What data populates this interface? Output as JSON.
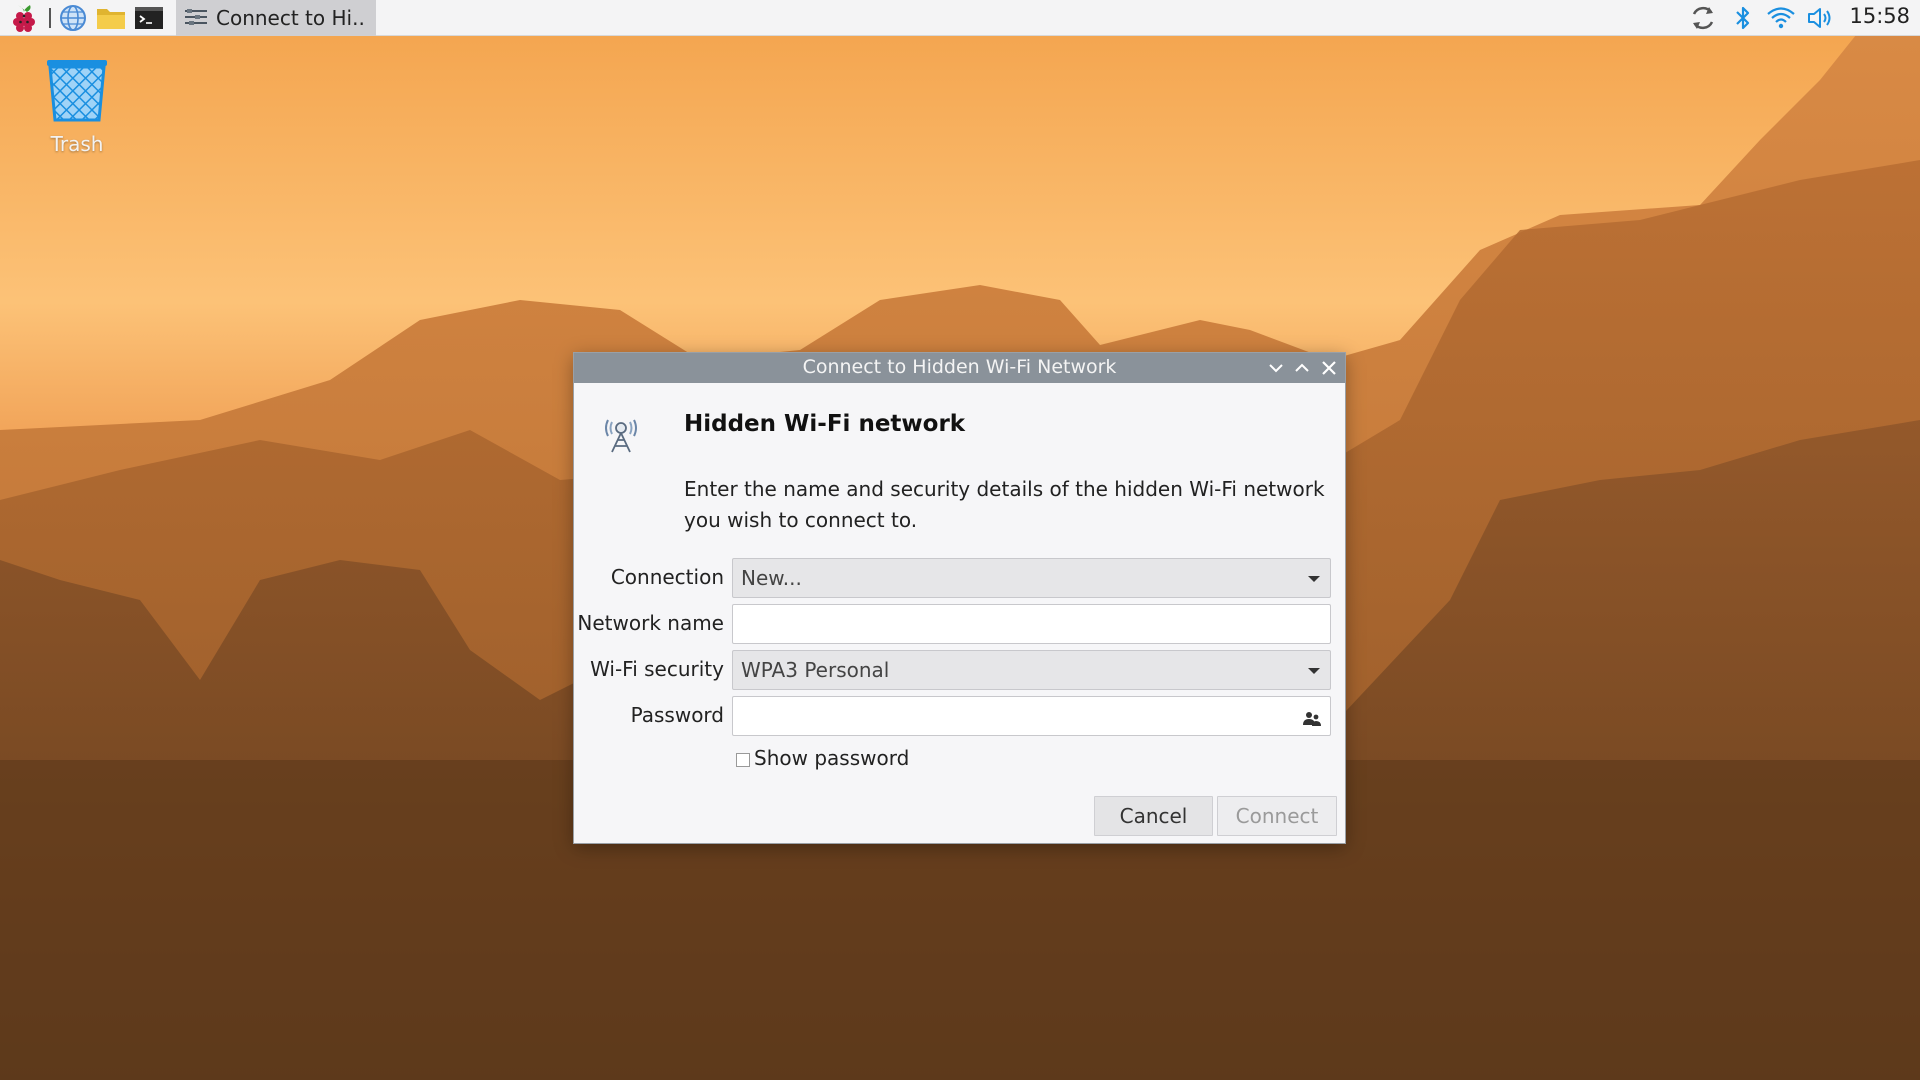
{
  "taskbar": {
    "active_task_label": "Connect to Hi..",
    "clock": "15:58",
    "icons": [
      "raspberry-menu-icon",
      "web-browser-icon",
      "file-manager-icon",
      "terminal-icon",
      "updater-icon",
      "bluetooth-icon",
      "wifi-icon",
      "volume-icon"
    ]
  },
  "desktop": {
    "trash_label": "Trash"
  },
  "dialog": {
    "title": "Connect to Hidden Wi-Fi Network",
    "heading": "Hidden Wi-Fi network",
    "description": "Enter the name and security details of the hidden Wi-Fi network you wish to connect to.",
    "connection_label": "Connection",
    "connection_value": "New...",
    "network_name_label": "Network name",
    "network_name_value": "",
    "wifi_security_label": "Wi-Fi security",
    "wifi_security_value": "WPA3 Personal",
    "password_label": "Password",
    "password_value": "",
    "show_password_label": "Show password",
    "show_password_checked": false,
    "cancel_label": "Cancel",
    "connect_label": "Connect"
  },
  "colors": {
    "titlebar": "#8a929a",
    "accent": "#1a8fe0",
    "dialog_bg": "#f6f6f8"
  }
}
